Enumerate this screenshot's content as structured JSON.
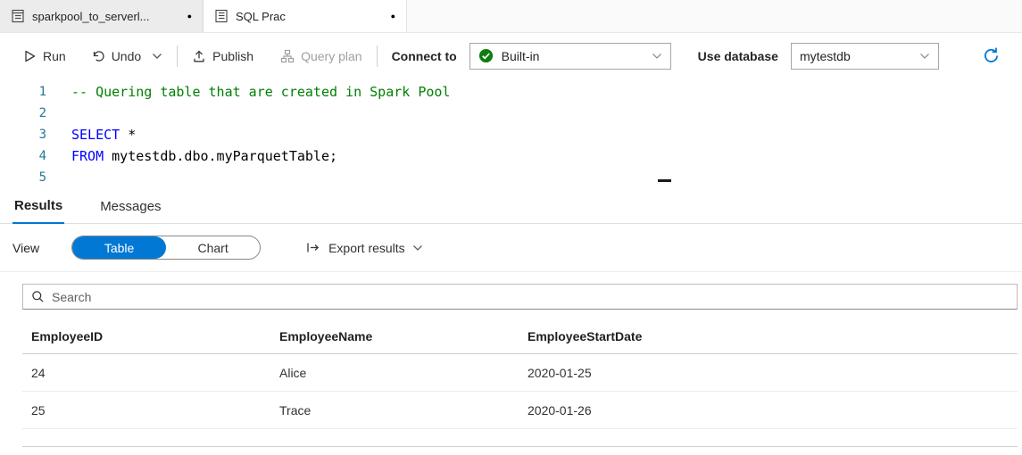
{
  "colors": {
    "accent": "#0078d4",
    "keyword": "#0000ff",
    "comment": "#008000",
    "success": "#107c10"
  },
  "editor_tabs": [
    {
      "label": "sparkpool_to_serverl...",
      "dirty_dot": "●"
    },
    {
      "label": "SQL Prac",
      "dirty_dot": "●"
    }
  ],
  "toolbar": {
    "run_label": "Run",
    "undo_label": "Undo",
    "publish_label": "Publish",
    "query_plan_label": "Query plan",
    "connect_to_label": "Connect to",
    "connect_value": "Built-in",
    "use_database_label": "Use database",
    "database_value": "mytestdb"
  },
  "editor": {
    "line_numbers": [
      "1",
      "2",
      "3",
      "4",
      "5"
    ],
    "line1_comment": "-- Quering table that are created in Spark Pool",
    "line3_keyword": "SELECT",
    "line3_code": " *",
    "line4_keyword": "FROM",
    "line4_code": " mytestdb.dbo.myParquetTable;"
  },
  "results_panel": {
    "tab_results": "Results",
    "tab_messages": "Messages",
    "view_label": "View",
    "toggle_table": "Table",
    "toggle_chart": "Chart",
    "export_label": "Export results"
  },
  "search": {
    "placeholder": "Search"
  },
  "results_table": {
    "columns": [
      "EmployeeID",
      "EmployeeName",
      "EmployeeStartDate"
    ],
    "rows": [
      [
        "24",
        "Alice",
        "2020-01-25"
      ],
      [
        "25",
        "Trace",
        "2020-01-26"
      ]
    ]
  }
}
